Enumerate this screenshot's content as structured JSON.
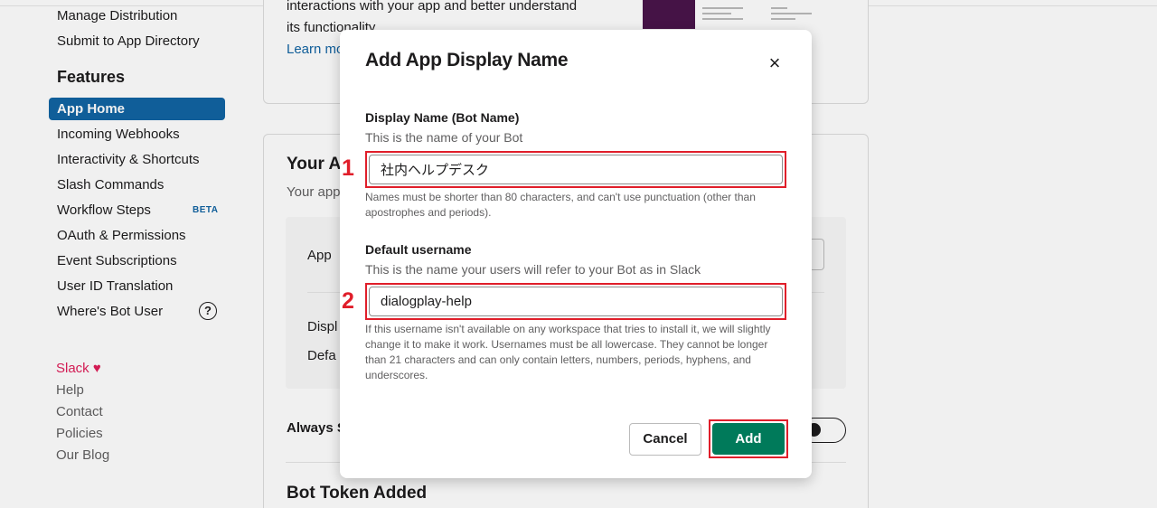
{
  "sidebar": {
    "top_links": [
      "Manage Distribution",
      "Submit to App Directory"
    ],
    "features_heading": "Features",
    "active_item": "App Home",
    "items": [
      "Incoming Webhooks",
      "Interactivity & Shortcuts",
      "Slash Commands",
      "Workflow Steps",
      "OAuth & Permissions",
      "Event Subscriptions",
      "User ID Translation",
      "Where's Bot User"
    ],
    "beta_badge": "BETA",
    "help_icon_glyph": "?",
    "footer": {
      "slack": "Slack",
      "heart": "♥",
      "links": [
        "Help",
        "Contact",
        "Policies",
        "Our Blog"
      ]
    }
  },
  "background": {
    "intro_line1": "interactions with your app and better understand",
    "intro_line2": "its functionality.",
    "learn_more": "Learn mo",
    "your_app_heading": "Your A",
    "your_app_sub": "Your app",
    "app_row": "App",
    "display_row": "Displ",
    "default_row": "Defa",
    "always_row": "Always S",
    "bot_token_heading": "Bot Token Added"
  },
  "modal": {
    "title": "Add App Display Name",
    "close_glyph": "×",
    "display_name": {
      "label": "Display Name (Bot Name)",
      "hint": "This is the name of your Bot",
      "value": "社内ヘルプデスク",
      "note": "Names must be shorter than 80 characters, and can't use punctuation (other than apostrophes and periods).",
      "marker": "1"
    },
    "default_username": {
      "label": "Default username",
      "hint": "This is the name your users will refer to your Bot as in Slack",
      "value": "dialogplay-help",
      "note": "If this username isn't available on any workspace that tries to install it, we will slightly change it to make it work. Usernames must be all lowercase. They cannot be longer than 21 characters and can only contain letters, numbers, periods, hyphens, and underscores.",
      "marker": "2"
    },
    "cancel_label": "Cancel",
    "add_label": "Add"
  },
  "colors": {
    "accent_blue": "#1264a3",
    "add_green": "#007a5a",
    "highlight_red": "#e01e2a",
    "slack_pink": "#e01e5a"
  }
}
